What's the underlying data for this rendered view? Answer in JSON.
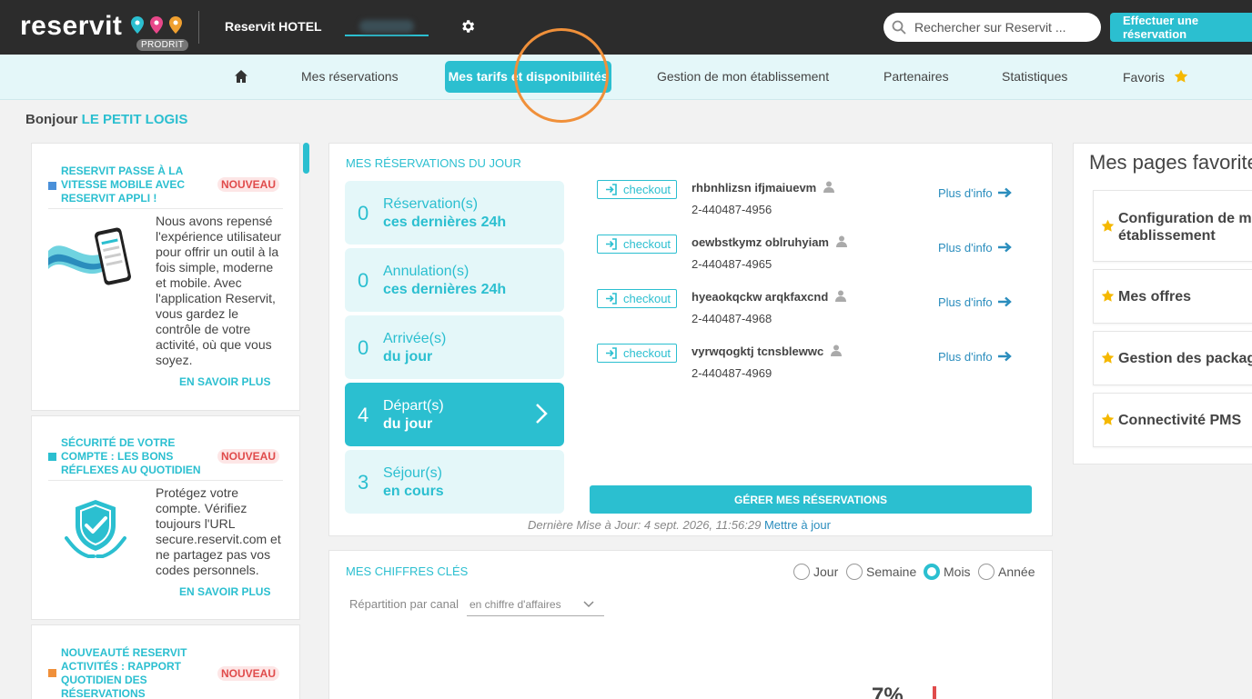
{
  "brand": {
    "logo_text": "reservit",
    "badge": "PRODRIT",
    "accent": "#2bbfd0"
  },
  "topbar": {
    "hotel_name": "Reservit HOTEL",
    "search_placeholder": "Rechercher sur Reservit ...",
    "book_button": "Effectuer une réservation"
  },
  "nav": {
    "items": [
      "Mes réservations",
      "Mes tarifs et disponibilités",
      "Gestion de mon établissement",
      "Partenaires",
      "Statistiques",
      "Favoris"
    ],
    "active_index": 1
  },
  "greeting": {
    "prefix": "Bonjour",
    "hotel": "LE PETIT LOGIS"
  },
  "news": [
    {
      "title": "RESERVIT PASSE À LA VITESSE MOBILE AVEC RESERVIT APPLI !",
      "badge": "NOUVEAU",
      "text": "Nous avons repensé l'expérience utilisateur pour offrir un outil à la fois simple, moderne et mobile. Avec l'application Reservit, vous gardez le contrôle de votre activité, où que vous soyez.",
      "link": "EN SAVOIR PLUS",
      "dot_color": "#4a90d9"
    },
    {
      "title": "SÉCURITÉ DE VOTRE COMPTE : LES BONS RÉFLEXES AU QUOTIDIEN",
      "badge": "NOUVEAU",
      "text": "Protégez votre compte. Vérifiez toujours l'URL secure.reservit.com et ne partagez pas vos codes personnels.",
      "link": "EN SAVOIR PLUS",
      "dot_color": "#2bbfd0"
    },
    {
      "title": "NOUVEAUTÉ RESERVIT ACTIVITÉS : RAPPORT QUOTIDIEN DES RÉSERVATIONS",
      "badge": "NOUVEAU",
      "dot_color": "#f0903a"
    }
  ],
  "reservations": {
    "title": "MES RÉSERVATIONS DU JOUR",
    "stats": [
      {
        "count": "0",
        "label": "Réservation(s)",
        "sub": "ces dernières 24h"
      },
      {
        "count": "0",
        "label": "Annulation(s)",
        "sub": "ces dernières 24h"
      },
      {
        "count": "0",
        "label": "Arrivée(s)",
        "sub": "du jour"
      },
      {
        "count": "4",
        "label": "Départ(s)",
        "sub": "du jour"
      },
      {
        "count": "3",
        "label": "Séjour(s)",
        "sub": "en cours"
      }
    ],
    "active_stat": 3,
    "rows": [
      {
        "action": "checkout",
        "name": "rhbnhlizsn ifjmaiuevm",
        "number": "2-440487-4956",
        "link": "Plus d'info"
      },
      {
        "action": "checkout",
        "name": "oewbstkymz oblruhyiam",
        "number": "2-440487-4965",
        "link": "Plus d'info"
      },
      {
        "action": "checkout",
        "name": "hyeaokqckw arqkfaxcnd",
        "number": "2-440487-4968",
        "link": "Plus d'info"
      },
      {
        "action": "checkout",
        "name": "vyrwqogktj tcnsblewwc",
        "number": "2-440487-4969",
        "link": "Plus d'info"
      }
    ],
    "manage_button": "GÉRER MES RÉSERVATIONS",
    "last_update": "Dernière Mise à Jour: 4 sept. 2026, 11:56:29",
    "refresh_link": "Mettre à jour"
  },
  "key_figures": {
    "title": "MES CHIFFRES CLÉS",
    "periods": [
      "Jour",
      "Semaine",
      "Mois",
      "Année"
    ],
    "selected_period": "Mois",
    "breakdown_label": "Répartition par canal",
    "breakdown_select": "en chiffre d'affaires",
    "visible_percent": "7%"
  },
  "favorites": {
    "title": "Mes pages favorites",
    "items": [
      {
        "line1": "Configuration de mon",
        "line2": "établissement"
      },
      {
        "line1": "Mes offres"
      },
      {
        "line1": "Gestion des packages"
      },
      {
        "line1": "Connectivité PMS"
      }
    ]
  }
}
